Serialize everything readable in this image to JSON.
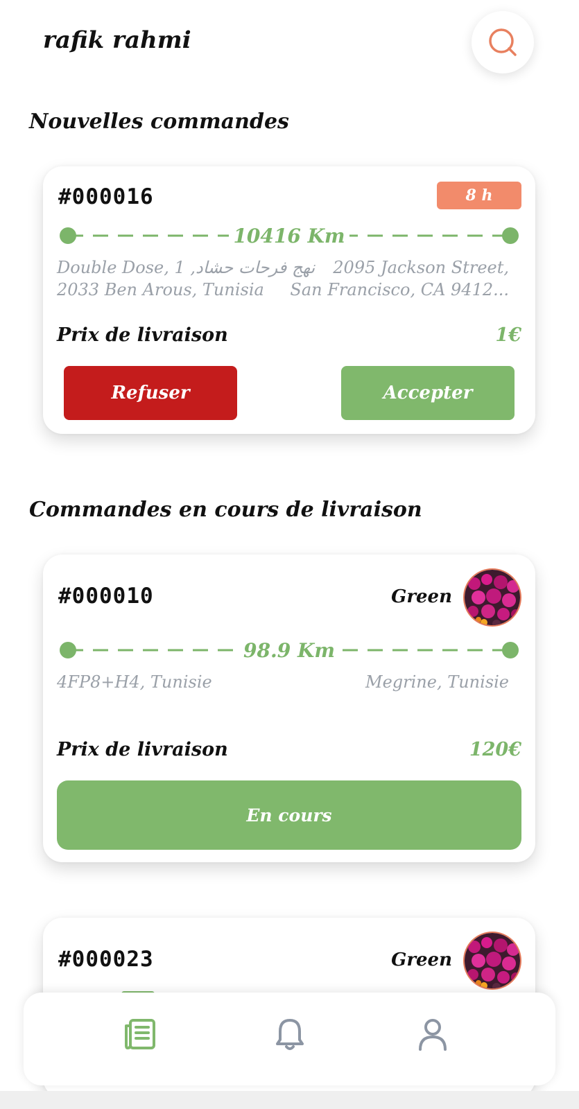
{
  "header": {
    "username": "rafik rahmi",
    "search_icon": "search-icon"
  },
  "sections": {
    "new_orders_title": "Nouvelles commandes",
    "in_delivery_title": "Commandes en cours de livraison"
  },
  "new_order": {
    "id": "#000016",
    "time_badge": "8 h",
    "distance": "10416 Km",
    "pickup_line1": "Double Dose, 1 ,نهج فرحات حشاد",
    "pickup_line2": "2033 Ben Arous, Tunisia",
    "dropoff_line1": "2095 Jackson Street,",
    "dropoff_line2": "San Francisco, CA 9412...",
    "price_label": "Prix de livraison",
    "price": "1€",
    "refuse_label": "Refuser",
    "accept_label": "Accepter"
  },
  "delivery_order_1": {
    "id": "#000010",
    "shop": "Green",
    "distance": "98.9 Km",
    "pickup": "4FP8+H4, Tunisie",
    "dropoff": "Megrine, Tunisie",
    "price_label": "Prix de livraison",
    "price": "120€",
    "status_label": "En cours"
  },
  "delivery_order_2": {
    "id": "#000023",
    "shop": "Green"
  },
  "bottom_nav": {
    "items": [
      {
        "icon": "orders-icon",
        "active": true
      },
      {
        "icon": "bell-icon",
        "active": false
      },
      {
        "icon": "user-icon",
        "active": false
      }
    ]
  },
  "colors": {
    "green": "#80B86C",
    "red": "#C41C1C",
    "orange": "#F28B6B",
    "gray_text": "#9AA0A8"
  }
}
